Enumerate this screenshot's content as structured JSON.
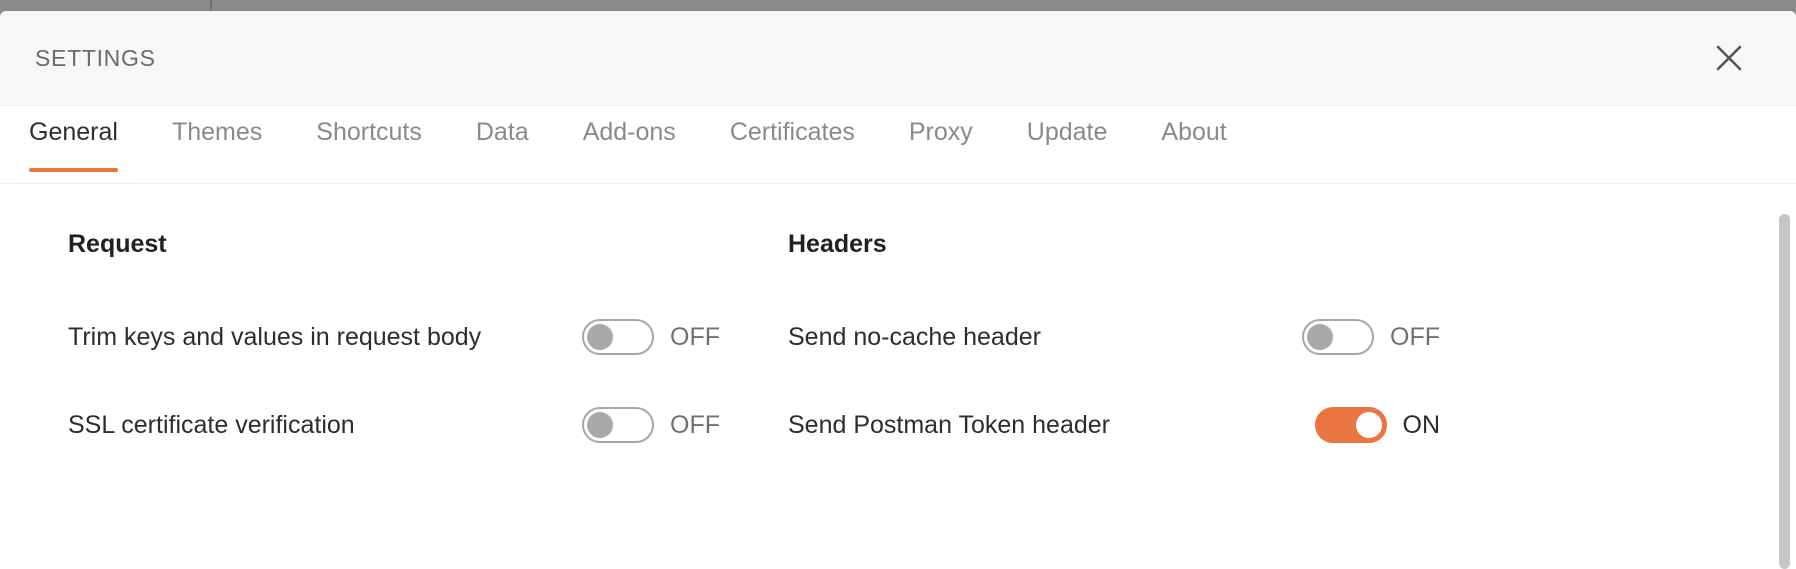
{
  "window": {
    "title": "SETTINGS",
    "close_icon": "close-icon"
  },
  "theme": {
    "accent": "#ea7442",
    "header_bg": "#f7f7f7",
    "backdrop": "#8a8a8a",
    "muted_text": "#8a8a8a",
    "body_text": "#2d2d2d"
  },
  "tabs": [
    {
      "label": "General",
      "active": true
    },
    {
      "label": "Themes",
      "active": false
    },
    {
      "label": "Shortcuts",
      "active": false
    },
    {
      "label": "Data",
      "active": false
    },
    {
      "label": "Add-ons",
      "active": false
    },
    {
      "label": "Certificates",
      "active": false
    },
    {
      "label": "Proxy",
      "active": false
    },
    {
      "label": "Update",
      "active": false
    },
    {
      "label": "About",
      "active": false
    }
  ],
  "columns": {
    "request": {
      "heading": "Request",
      "settings": [
        {
          "label": "Trim keys and values in request body",
          "state": "OFF",
          "on": false
        },
        {
          "label": "SSL certificate verification",
          "state": "OFF",
          "on": false
        }
      ]
    },
    "headers": {
      "heading": "Headers",
      "settings": [
        {
          "label": "Send no-cache header",
          "state": "OFF",
          "on": false
        },
        {
          "label": "Send Postman Token header",
          "state": "ON",
          "on": true
        }
      ]
    }
  }
}
